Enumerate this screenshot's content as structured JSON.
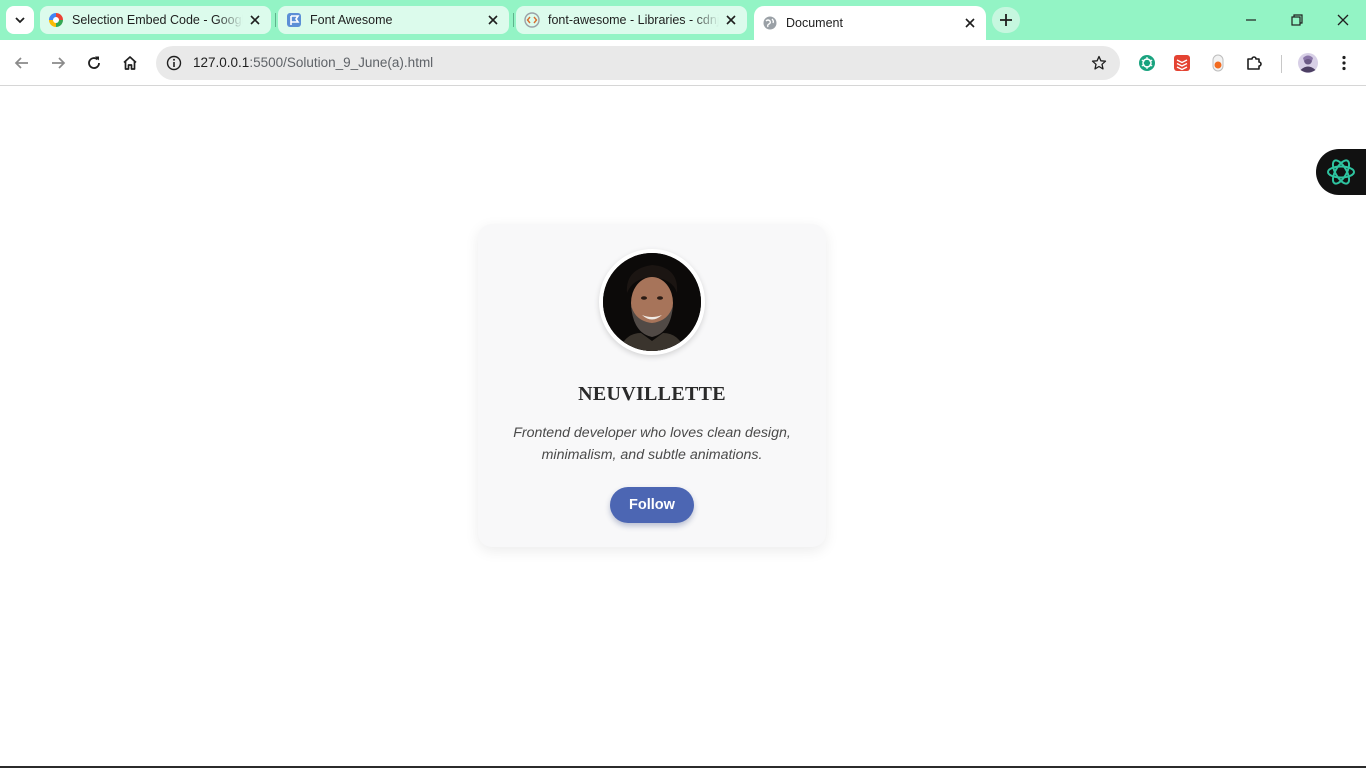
{
  "browser": {
    "tabs": [
      {
        "title": "Selection Embed Code - Google",
        "favicon": "google-icon",
        "active": false
      },
      {
        "title": "Font Awesome",
        "favicon": "font-awesome-icon",
        "active": false
      },
      {
        "title": "font-awesome - Libraries - cdnjs",
        "favicon": "cdnjs-icon",
        "active": false
      },
      {
        "title": "Document",
        "favicon": "globe-icon",
        "active": true
      }
    ],
    "url_host": "127.0.0.1",
    "url_path": ":5500/Solution_9_June(a).html",
    "theme_color": "#93f4c5"
  },
  "profile": {
    "name": "NEUVILLETTE",
    "bio": "Frontend developer who loves clean design, minimalism, and subtle animations.",
    "follow_label": "Follow",
    "accent_color": "#4c66b3"
  }
}
